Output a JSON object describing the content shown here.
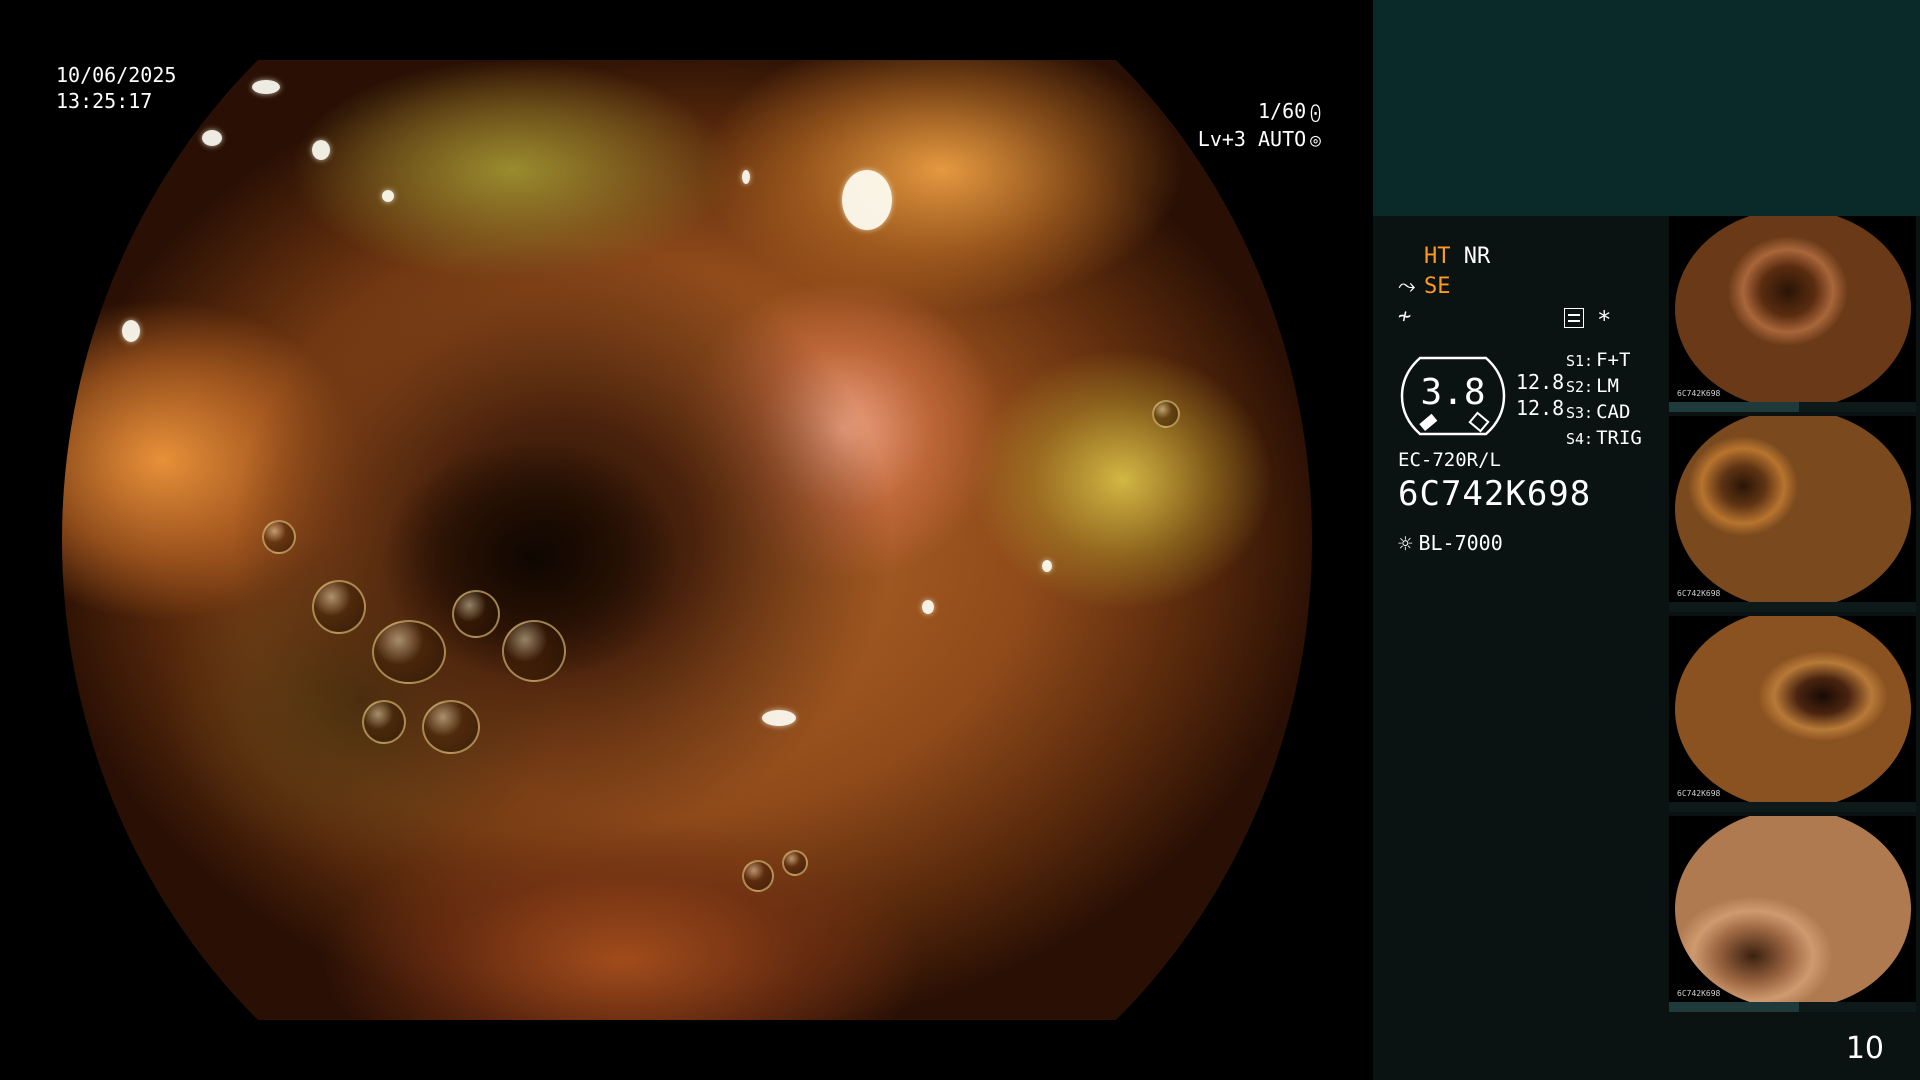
{
  "osd": {
    "date": "10/06/2025",
    "time": "13:25:17",
    "shutter": "1/60",
    "shutter_icon": "iris-icon",
    "level": "Lv+3 AUTO",
    "level_icon": "auto-exposure-icon"
  },
  "panel": {
    "modes": {
      "ht": "HT",
      "nr": "NR",
      "se_glyph": "⤳",
      "se": "SE",
      "f_glyph": "≁"
    },
    "gauge": {
      "value": "3.8",
      "sub1": "12.8",
      "sub2": "12.8"
    },
    "switches": [
      {
        "key": "S1:",
        "value": "F+T"
      },
      {
        "key": "S2:",
        "value": "LM"
      },
      {
        "key": "S3:",
        "value": "CAD"
      },
      {
        "key": "S4:",
        "value": "TRIG"
      }
    ],
    "scope_model": "EC-720R/L",
    "scope_serial": "6C742K698",
    "light_icon": "light-source-icon",
    "light_source": "BL-7000",
    "star": "*",
    "page_number": "10"
  },
  "thumbnails": [
    {
      "caption": "6C742K698",
      "index": 1
    },
    {
      "caption": "6C742K698",
      "index": 2
    },
    {
      "caption": "6C742K698",
      "index": 3
    },
    {
      "caption": "6C742K698",
      "index": 4
    }
  ],
  "colors": {
    "accent": "#ff9a1e",
    "panel_top": "#0a2a2a",
    "panel_body": "#0a1212"
  }
}
